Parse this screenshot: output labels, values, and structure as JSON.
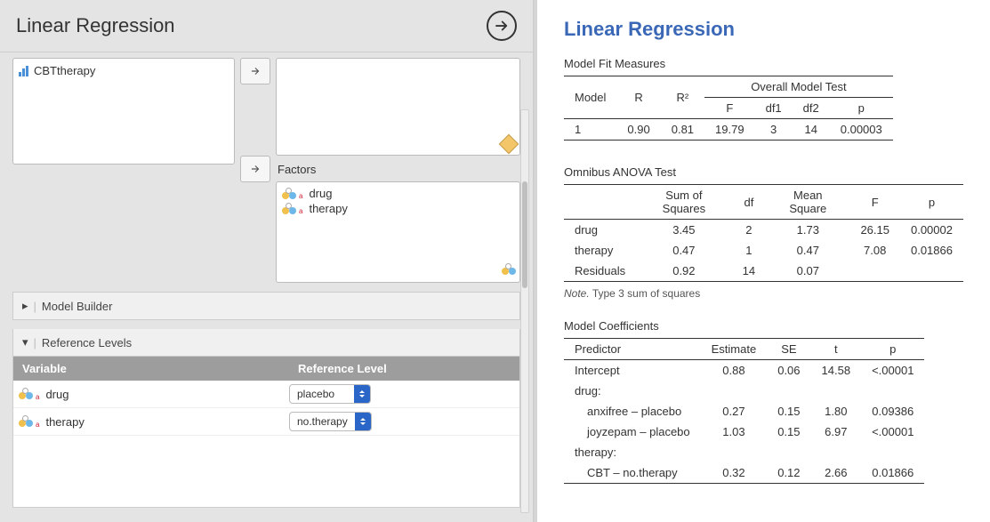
{
  "header": {
    "title": "Linear Regression"
  },
  "variables": {
    "available": [
      "CBTtherapy"
    ]
  },
  "factors": {
    "label": "Factors",
    "items": [
      "drug",
      "therapy"
    ]
  },
  "sections": {
    "model_builder": "Model Builder",
    "reference_levels": "Reference Levels"
  },
  "refLevels": {
    "header_variable": "Variable",
    "header_reflevel": "Reference Level",
    "rows": [
      {
        "variable": "drug",
        "level": "placebo"
      },
      {
        "variable": "therapy",
        "level": "no.therapy"
      }
    ]
  },
  "results": {
    "title": "Linear Regression",
    "fit": {
      "title": "Model Fit Measures",
      "overall_label": "Overall Model Test",
      "cols": {
        "model": "Model",
        "r": "R",
        "r2": "R²",
        "f": "F",
        "df1": "df1",
        "df2": "df2",
        "p": "p"
      },
      "row": {
        "model": "1",
        "r": "0.90",
        "r2": "0.81",
        "f": "19.79",
        "df1": "3",
        "df2": "14",
        "p": "0.00003"
      }
    },
    "anova": {
      "title": "Omnibus ANOVA Test",
      "cols": {
        "ss": "Sum of Squares",
        "df": "df",
        "ms": "Mean Square",
        "f": "F",
        "p": "p"
      },
      "rows": [
        {
          "name": "drug",
          "ss": "3.45",
          "df": "2",
          "ms": "1.73",
          "f": "26.15",
          "p": "0.00002"
        },
        {
          "name": "therapy",
          "ss": "0.47",
          "df": "1",
          "ms": "0.47",
          "f": "7.08",
          "p": "0.01866"
        },
        {
          "name": "Residuals",
          "ss": "0.92",
          "df": "14",
          "ms": "0.07",
          "f": "",
          "p": ""
        }
      ],
      "note_label": "Note.",
      "note": "Type 3 sum of squares"
    },
    "coef": {
      "title": "Model Coefficients",
      "cols": {
        "pred": "Predictor",
        "est": "Estimate",
        "se": "SE",
        "t": "t",
        "p": "p"
      },
      "intercept": {
        "name": "Intercept",
        "est": "0.88",
        "se": "0.06",
        "t": "14.58",
        "p": "<.00001"
      },
      "drug_label": "drug:",
      "drug_rows": [
        {
          "name": "anxifree – placebo",
          "est": "0.27",
          "se": "0.15",
          "t": "1.80",
          "p": "0.09386"
        },
        {
          "name": "joyzepam – placebo",
          "est": "1.03",
          "se": "0.15",
          "t": "6.97",
          "p": "<.00001"
        }
      ],
      "therapy_label": "therapy:",
      "therapy_rows": [
        {
          "name": "CBT – no.therapy",
          "est": "0.32",
          "se": "0.12",
          "t": "2.66",
          "p": "0.01866"
        }
      ]
    }
  }
}
